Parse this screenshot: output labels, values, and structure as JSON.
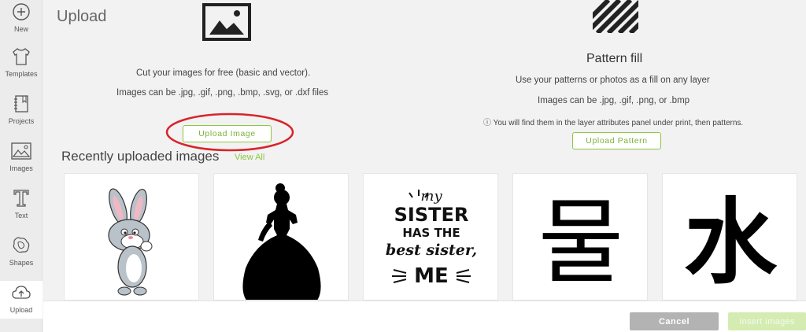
{
  "sidebar": {
    "items": [
      {
        "label": "New",
        "icon": "plus-circle-icon"
      },
      {
        "label": "Templates",
        "icon": "tshirt-icon"
      },
      {
        "label": "Projects",
        "icon": "notebook-icon"
      },
      {
        "label": "Images",
        "icon": "image-icon"
      },
      {
        "label": "Text",
        "icon": "text-t-icon"
      },
      {
        "label": "Shapes",
        "icon": "shapes-icon"
      },
      {
        "label": "Upload",
        "icon": "cloud-upload-icon"
      }
    ],
    "active": "Upload"
  },
  "upload": {
    "title": "Upload",
    "line1": "Cut your images for free (basic and vector).",
    "line2": "Images can be .jpg, .gif, .png, .bmp, .svg, or .dxf files",
    "button": "Upload Image"
  },
  "pattern": {
    "title": "Pattern fill",
    "line1": "Use your patterns or photos as a fill on any layer",
    "line2": "Images can be .jpg, .gif, .png, or .bmp",
    "info": "You will find them in the layer attributes panel under print, then patterns.",
    "button": "Upload Pattern"
  },
  "recent": {
    "title": "Recently uploaded images",
    "view_all": "View All",
    "thumbnails": [
      {
        "name": "baby-bunny-cartoon"
      },
      {
        "name": "princess-silhouette"
      },
      {
        "name": "my-sister-has-the-best-sister-me",
        "text": [
          "my",
          "SISTER",
          "HAS THE",
          "best sister,",
          "ME"
        ]
      },
      {
        "name": "korean-water-character",
        "text": "물"
      },
      {
        "name": "kanji-water-character",
        "text": "水"
      }
    ]
  },
  "footer": {
    "cancel": "Cancel",
    "insert": "Insert Images"
  },
  "colors": {
    "accent_green": "#8dc63f",
    "annotation_red": "#d9232a"
  }
}
